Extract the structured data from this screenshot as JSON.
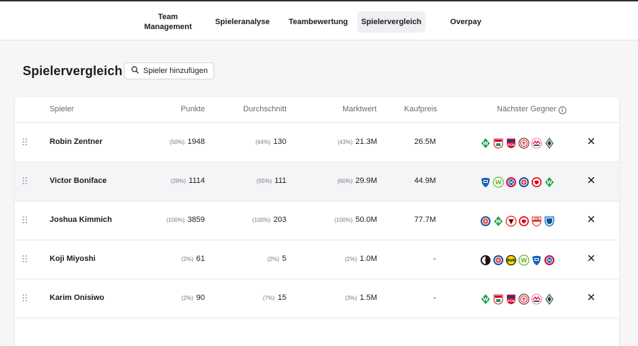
{
  "nav": {
    "items": [
      {
        "label": "Team\nManagement",
        "active": false
      },
      {
        "label": "Spieleranalyse",
        "active": false
      },
      {
        "label": "Teambewertung",
        "active": false
      },
      {
        "label": "Spielervergleich",
        "active": true
      },
      {
        "label": "Overpay",
        "active": false
      }
    ]
  },
  "page": {
    "title": "Spielervergleich",
    "add_button_label": "Spieler hinzufügen",
    "add_button_icon": "search-icon"
  },
  "table": {
    "headers": {
      "player": "Spieler",
      "points": "Punkte",
      "average": "Durchschnitt",
      "market_value": "Marktwert",
      "purchase_price": "Kaufpreis",
      "next_opponent": "Nächster Gegner",
      "next_opponent_icon": "info-icon"
    },
    "rows": [
      {
        "name": "Robin Zentner",
        "points_pct": "(50%)",
        "points": "1948",
        "avg_pct": "(64%)",
        "avg": "130",
        "mv_pct": "(43%)",
        "mv": "21.3M",
        "buy": "26.5M",
        "opponents": [
          "werder-bremen-crest",
          "augsburg-crest",
          "heidenheim-crest",
          "st-pauli-crest",
          "leipzig-crest",
          "gladbach-crest"
        ],
        "remove_icon": "close-icon"
      },
      {
        "name": "Victor Boniface",
        "points_pct": "(29%)",
        "points": "1114",
        "avg_pct": "(55%)",
        "avg": "111",
        "mv_pct": "(60%)",
        "mv": "29.9M",
        "buy": "44.9M",
        "opponents": [
          "hoffenheim-crest",
          "wolfsburg-crest",
          "bayern-crest",
          "kiel-crest",
          "frankfurt-crest",
          "werder-bremen-crest"
        ],
        "remove_icon": "close-icon"
      },
      {
        "name": "Joshua Kimmich",
        "points_pct": "(100%)",
        "points": "3859",
        "avg_pct": "(100%)",
        "avg": "203",
        "mv_pct": "(100%)",
        "mv": "50.0M",
        "buy": "77.7M",
        "opponents": [
          "kiel-crest",
          "werder-bremen-crest",
          "leverkusen-crest",
          "frankfurt-crest",
          "stuttgart-crest",
          "bochum-crest"
        ],
        "remove_icon": "close-icon"
      },
      {
        "name": "Koji Miyoshi",
        "points_pct": "(2%)",
        "points": "61",
        "avg_pct": "(2%)",
        "avg": "5",
        "mv_pct": "(2%)",
        "mv": "1.0M",
        "buy": "-",
        "opponents": [
          "freiburg-crest",
          "kiel-crest",
          "dortmund-crest",
          "wolfsburg-crest",
          "hoffenheim-crest",
          "bayern-crest"
        ],
        "remove_icon": "close-icon"
      },
      {
        "name": "Karim Onisiwo",
        "points_pct": "(2%)",
        "points": "90",
        "avg_pct": "(7%)",
        "avg": "15",
        "mv_pct": "(3%)",
        "mv": "1.5M",
        "buy": "-",
        "opponents": [
          "werder-bremen-crest",
          "augsburg-crest",
          "heidenheim-crest",
          "st-pauli-crest",
          "leipzig-crest",
          "gladbach-crest"
        ],
        "remove_icon": "close-icon"
      }
    ]
  },
  "colors": {
    "text": "#1d1d1f",
    "muted": "#6b6b70",
    "active_nav_bg": "#eef0f3",
    "row_alt_bg": "#f4f5f7"
  }
}
